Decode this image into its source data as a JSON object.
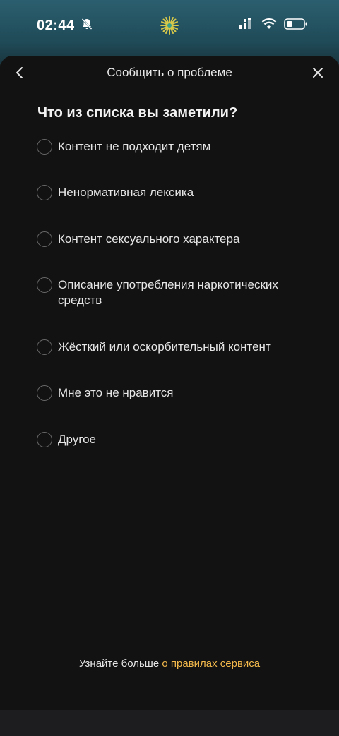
{
  "status_bar": {
    "time": "02:44",
    "icons": [
      "bell-muted-icon",
      "app-sun-icon",
      "signal-icon",
      "wifi-icon",
      "battery-icon"
    ]
  },
  "header": {
    "title": "Сообщить о проблеме",
    "back_icon": "chevron-left-icon",
    "close_icon": "close-icon"
  },
  "question": "Что из списка вы заметили?",
  "options": [
    {
      "label": "Контент не подходит детям",
      "selected": false
    },
    {
      "label": "Ненормативная лексика",
      "selected": false
    },
    {
      "label": "Контент сексуального характера",
      "selected": false
    },
    {
      "label": "Описание употребления наркотических средств",
      "selected": false
    },
    {
      "label": "Жёсткий или оскорбительный контент",
      "selected": false
    },
    {
      "label": "Мне это не нравится",
      "selected": false
    },
    {
      "label": "Другое",
      "selected": false
    }
  ],
  "footer": {
    "prefix": "Узнайте больше ",
    "link": "о правилах сервиса"
  },
  "colors": {
    "accent_link": "#f2b84b",
    "sheet_bg": "#121212",
    "status_bg": "#2b5f6f"
  }
}
